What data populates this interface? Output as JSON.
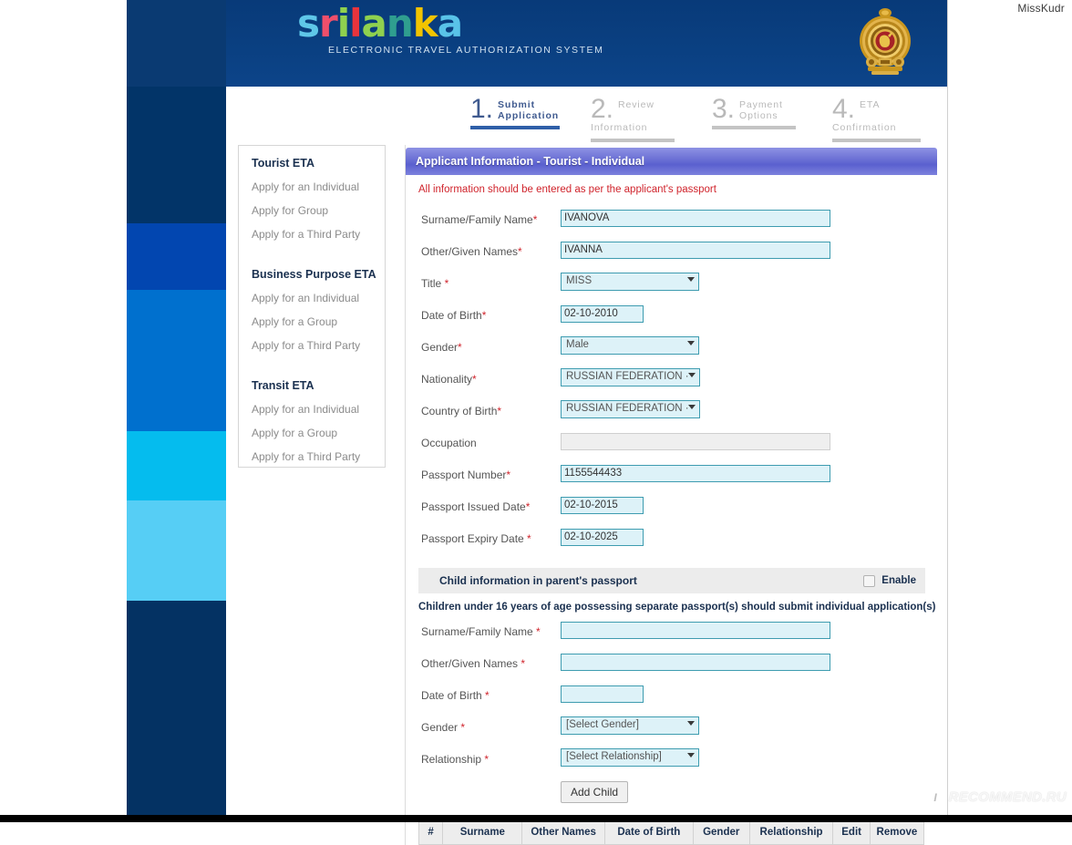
{
  "account": {
    "name": "MissKudr"
  },
  "header": {
    "logo_letters": [
      {
        "ch": "s",
        "cls": "l-s"
      },
      {
        "ch": "r",
        "cls": "l-r"
      },
      {
        "ch": "i",
        "cls": "l-i"
      },
      {
        "ch": "l",
        "cls": "l-l"
      },
      {
        "ch": "a",
        "cls": "l-a1"
      },
      {
        "ch": "n",
        "cls": "l-n"
      },
      {
        "ch": "k",
        "cls": "l-k"
      },
      {
        "ch": "a",
        "cls": "l-a2"
      }
    ],
    "tagline": "ELECTRONIC TRAVEL AUTHORIZATION SYSTEM",
    "emblem_alt": "sri-lanka-national-emblem"
  },
  "steps": [
    {
      "num": "1.",
      "line1": "Submit",
      "line2": "Application",
      "active": true
    },
    {
      "num": "2.",
      "line1": "Review",
      "line2": "Information",
      "active": false
    },
    {
      "num": "3.",
      "line1": "Payment",
      "line2": "Options",
      "active": false
    },
    {
      "num": "4.",
      "line1": "ETA",
      "line2": "Confirmation",
      "active": false
    }
  ],
  "sidebar": {
    "groups": [
      {
        "title": "Tourist ETA",
        "links": [
          "Apply for an Individual",
          "Apply for Group",
          "Apply for a Third Party"
        ]
      },
      {
        "title": "Business Purpose ETA",
        "links": [
          "Apply for an Individual",
          "Apply for a Group",
          "Apply for a Third Party"
        ]
      },
      {
        "title": "Transit ETA",
        "links": [
          "Apply for an Individual",
          "Apply for a Group",
          "Apply for a Third Party"
        ]
      }
    ]
  },
  "panel": {
    "title": "Applicant Information - Tourist - Individual",
    "notice": "All information should be entered as per the applicant's passport",
    "help_glyph": "?",
    "fields": {
      "surname": {
        "label": "Surname/Family Name",
        "req": "*",
        "value": "IVANOVA"
      },
      "given_names": {
        "label": "Other/Given Names",
        "req": "*",
        "value": "IVANNA"
      },
      "title": {
        "label": "Title ",
        "req": "*",
        "value": "MISS"
      },
      "dob": {
        "label": "Date of Birth",
        "req": "*",
        "value": "02-10-2010"
      },
      "gender": {
        "label": "Gender",
        "req": "*",
        "value": "Male"
      },
      "nationality": {
        "label": "Nationality",
        "req": "*",
        "value": "RUSSIAN FEDERATION ·"
      },
      "country_birth": {
        "label": "Country of Birth",
        "req": "*",
        "value": "RUSSIAN FEDERATION ·"
      },
      "occupation": {
        "label": "Occupation",
        "req": "",
        "value": ""
      },
      "passport_no": {
        "label": "Passport Number",
        "req": "*",
        "value": "1155544433"
      },
      "passport_issued": {
        "label": "Passport Issued Date",
        "req": "*",
        "value": "02-10-2015"
      },
      "passport_expiry": {
        "label": "Passport Expiry Date ",
        "req": "*",
        "value": "02-10-2025"
      }
    }
  },
  "child": {
    "bar_title": "Child information in parent's passport",
    "enable_label": "Enable",
    "enabled": false,
    "note": "Children under 16 years of age possessing separate passport(s) should submit individual application(s)",
    "fields": {
      "surname": {
        "label": "Surname/Family Name ",
        "req": "*",
        "value": ""
      },
      "given_names": {
        "label": "Other/Given Names ",
        "req": "*",
        "value": ""
      },
      "dob": {
        "label": "Date of Birth ",
        "req": "*",
        "value": ""
      },
      "gender": {
        "label": "Gender ",
        "req": "*",
        "value": "[Select Gender]"
      },
      "relationship": {
        "label": "Relationship ",
        "req": "*",
        "value": "[Select Relationship]"
      }
    },
    "add_button": "Add Child",
    "table_headers": [
      "#",
      "Surname",
      "Other Names",
      "Date of Birth",
      "Gender",
      "Relationship",
      "Edit",
      "Remove"
    ]
  },
  "watermark": {
    "badge": "I",
    "text": "RECOMMEND.RU"
  }
}
